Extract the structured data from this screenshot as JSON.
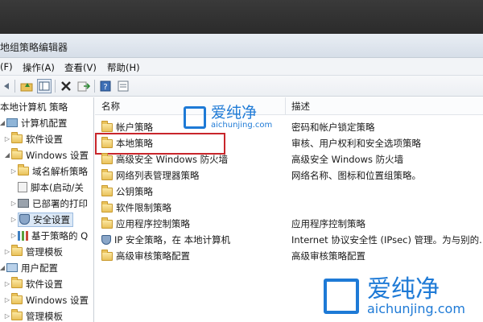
{
  "window": {
    "title": "地组策略编辑器"
  },
  "menu": [
    "(F)",
    "操作(A)",
    "查看(V)",
    "帮助(H)"
  ],
  "toolbar": {
    "buttons": [
      "back-icon",
      "up-folder-icon",
      "show-hide-tree-icon",
      "delete-icon",
      "export-icon",
      "help-icon",
      "properties-icon"
    ]
  },
  "tree": [
    {
      "label": "本地计算机 策略",
      "icon": "computer-policy-icon"
    },
    {
      "label": "计算机配置",
      "icon": "computer-icon"
    },
    {
      "label": "软件设置",
      "icon": "folder-icon"
    },
    {
      "label": "Windows 设置",
      "icon": "folder-icon"
    },
    {
      "label": "域名解析策略",
      "icon": "folder-icon"
    },
    {
      "label": "脚本(启动/关",
      "icon": "script-icon"
    },
    {
      "label": "已部署的打印",
      "icon": "printer-icon"
    },
    {
      "label": "安全设置",
      "icon": "shield-icon",
      "selected": true
    },
    {
      "label": "基于策略的 Q",
      "icon": "chart-icon"
    },
    {
      "label": "管理模板",
      "icon": "folder-icon"
    },
    {
      "label": "用户配置",
      "icon": "user-icon"
    },
    {
      "label": "软件设置",
      "icon": "folder-icon"
    },
    {
      "label": "Windows 设置",
      "icon": "folder-icon"
    },
    {
      "label": "管理模板",
      "icon": "folder-icon"
    }
  ],
  "columns": {
    "name": "名称",
    "description": "描述"
  },
  "rows": [
    {
      "name": "帐户策略",
      "description": "密码和帐户锁定策略"
    },
    {
      "name": "本地策略",
      "description": "审核、用户权利和安全选项策略",
      "highlighted": true
    },
    {
      "name": "高级安全 Windows 防火墙",
      "description": "高级安全 Windows 防火墙"
    },
    {
      "name": "网络列表管理器策略",
      "description": "网络名称、图标和位置组策略。"
    },
    {
      "name": "公钥策略",
      "description": ""
    },
    {
      "name": "软件限制策略",
      "description": ""
    },
    {
      "name": "应用程序控制策略",
      "description": "应用程序控制策略"
    },
    {
      "name": "IP 安全策略，在 本地计算机",
      "description": "Internet 协议安全性 (IPsec) 管理。为与别的..."
    },
    {
      "name": "高级审核策略配置",
      "description": "高级审核策略配置"
    }
  ],
  "watermarks": [
    {
      "brand": "爱纯净",
      "url": "aichunjing.com"
    },
    {
      "brand": "爱纯净",
      "url": "aichunjing.com"
    }
  ],
  "colors": {
    "highlight_border": "#c8262b",
    "watermark": "#1e7ad6"
  }
}
